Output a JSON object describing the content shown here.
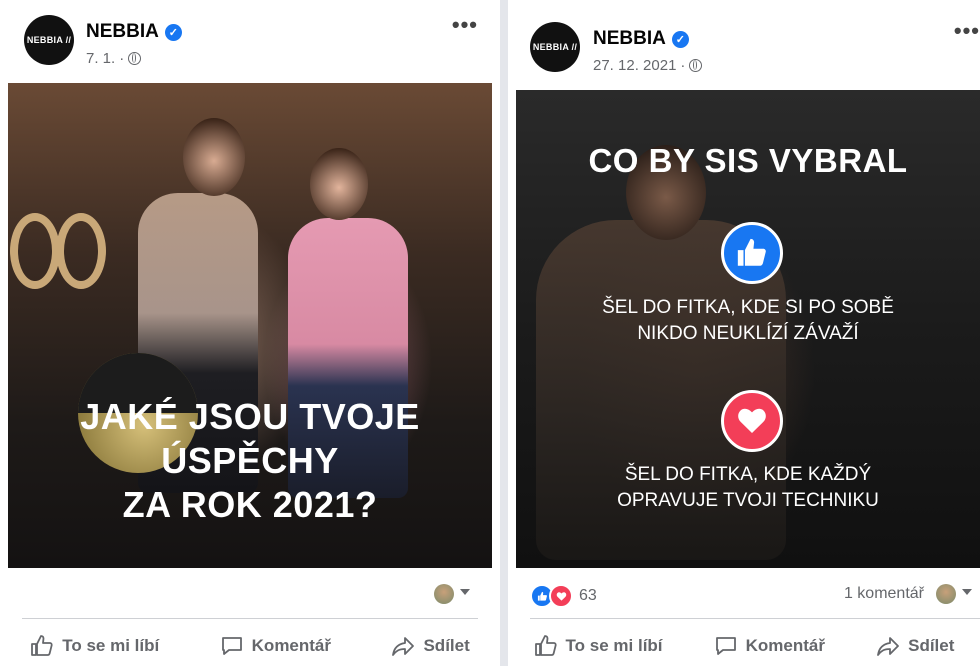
{
  "posts": [
    {
      "page_name": "NEBBIA",
      "avatar_text": "NEBBIA //",
      "date": "7. 1.",
      "separator": "·",
      "image_text_lines": [
        "JAKÉ JSOU TVOJE",
        "ÚSPĚCHY",
        "ZA ROK 2021?"
      ],
      "reactions": null,
      "comments": null,
      "actions": {
        "like": "To se mi líbí",
        "comment": "Komentář",
        "share": "Sdílet"
      }
    },
    {
      "page_name": "NEBBIA",
      "avatar_text": "NEBBIA //",
      "date": "27. 12. 2021",
      "separator": "·",
      "image_title": "CO BY SIS VYBRAL",
      "option_like_lines": [
        "ŠEL DO FITKA, KDE SI PO SOBĚ",
        "NIKDO NEUKLÍZÍ ZÁVAŽÍ"
      ],
      "option_love_lines": [
        "ŠEL DO FITKA, KDE KAŽDÝ",
        "OPRAVUJE TVOJI TECHNIKU"
      ],
      "reactions": "63",
      "comments": "1 komentář",
      "actions": {
        "like": "To se mi líbí",
        "comment": "Komentář",
        "share": "Sdílet"
      }
    }
  ],
  "icons": {
    "verified": "verified-badge-icon",
    "privacy": "globe-icon",
    "more": "more-options-icon",
    "like": "thumbs-up-icon",
    "love": "heart-icon",
    "comment": "speech-bubble-icon",
    "share": "share-arrow-icon"
  },
  "colors": {
    "facebook_blue": "#1877f2",
    "love_red": "#f33e58",
    "secondary_text": "#65676b"
  }
}
